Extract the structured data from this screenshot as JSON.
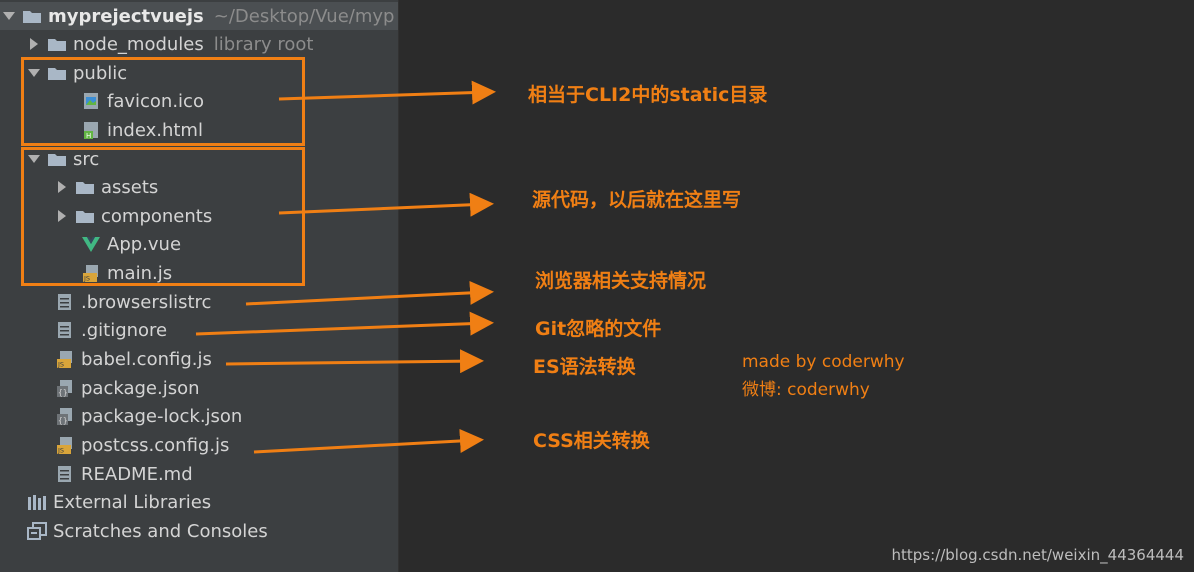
{
  "tree": {
    "root": {
      "name": "myprejectvuejs",
      "path": "~/Desktop/Vue/myp"
    },
    "items": [
      {
        "name": "node_modules",
        "hint": "library root"
      },
      {
        "name": "public"
      },
      {
        "name": "favicon.ico"
      },
      {
        "name": "index.html"
      },
      {
        "name": "src"
      },
      {
        "name": "assets"
      },
      {
        "name": "components"
      },
      {
        "name": "App.vue"
      },
      {
        "name": "main.js"
      },
      {
        "name": ".browserslistrc"
      },
      {
        "name": ".gitignore"
      },
      {
        "name": "babel.config.js"
      },
      {
        "name": "package.json"
      },
      {
        "name": "package-lock.json"
      },
      {
        "name": "postcss.config.js"
      },
      {
        "name": "README.md"
      },
      {
        "name": "External Libraries"
      },
      {
        "name": "Scratches and Consoles"
      }
    ]
  },
  "annotations": {
    "public": "相当于CLI2中的static目录",
    "src": "源代码，以后就在这里写",
    "browserslistrc": "浏览器相关支持情况",
    "gitignore": "Git忽略的文件",
    "babel": "ES语法转换",
    "postcss": "CSS相关转换"
  },
  "credit": {
    "line1": "made by coderwhy",
    "line2": "微博: coderwhy"
  },
  "watermark": "https://blog.csdn.net/weixin_44364444",
  "colors": {
    "accent": "#f07f14",
    "panel": "#3c3f41",
    "background": "#2b2b2b"
  }
}
